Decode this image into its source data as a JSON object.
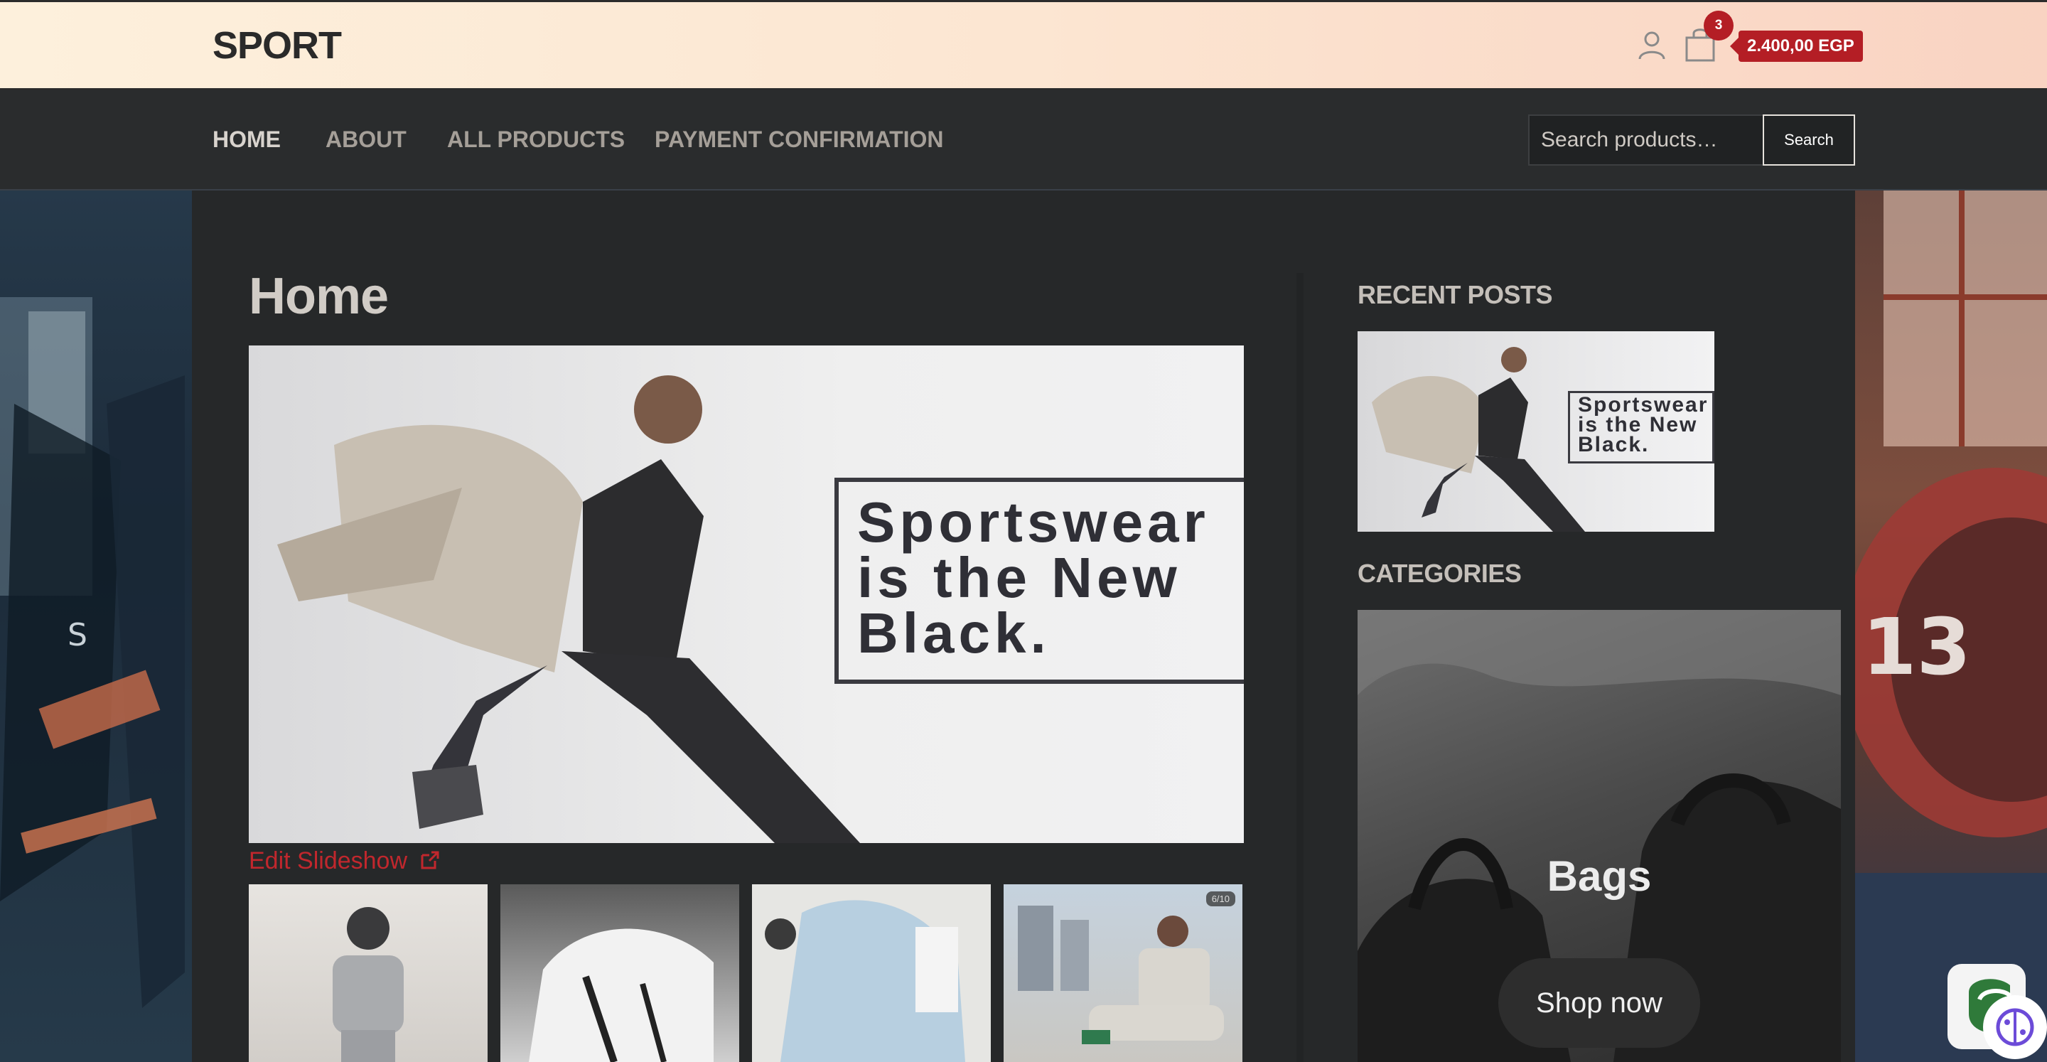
{
  "header": {
    "logo": "SPORT",
    "cart_count": "3",
    "cart_total": "2.400,00 EGP"
  },
  "nav": {
    "items": [
      {
        "label": "HOME",
        "active": true
      },
      {
        "label": "ABOUT",
        "active": false
      },
      {
        "label": "ALL PRODUCTS",
        "active": false
      },
      {
        "label": "PAYMENT CONFIRMATION",
        "active": false
      }
    ],
    "search_placeholder": "Search products…",
    "search_button": "Search"
  },
  "main": {
    "title": "Home",
    "hero_text": "Sportswear is the New Black.",
    "edit_slideshow": "Edit Slideshow",
    "thumb_counter": "6/10"
  },
  "sidebar": {
    "recent_posts_heading": "RECENT POSTS",
    "recent_post_text": "Sportswear is the New Black.",
    "categories_heading": "CATEGORIES",
    "category_name": "Bags",
    "shop_now": "Shop now"
  },
  "colors": {
    "accent_red": "#b41e25",
    "nav_bg": "#2a2c2d",
    "header_gradient_start": "#fdf0dc",
    "header_gradient_end": "#f9d3c2"
  }
}
